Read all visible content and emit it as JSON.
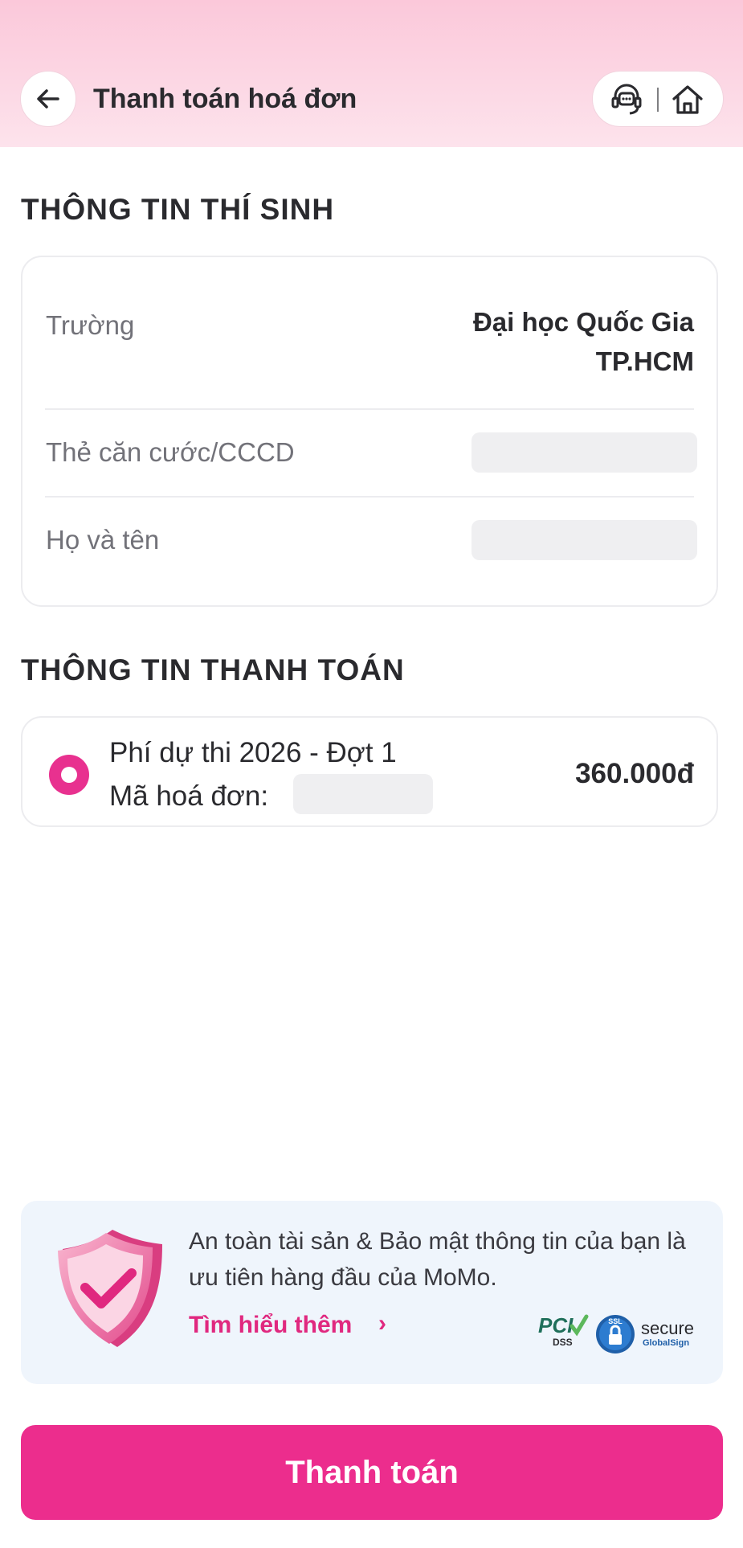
{
  "header": {
    "title": "Thanh toán hoá đơn",
    "back_icon": "arrow-left-icon",
    "support_icon": "support-chat-icon",
    "home_icon": "home-icon"
  },
  "candidate": {
    "section_title": "THÔNG TIN THÍ SINH",
    "rows": [
      {
        "label": "Trường",
        "value_line1": "Đại học Quốc Gia",
        "value_line2": "TP.HCM"
      },
      {
        "label": "Thẻ căn cước/CCCD",
        "value": ""
      },
      {
        "label": "Họ và tên",
        "value": ""
      }
    ]
  },
  "payment": {
    "section_title": "THÔNG TIN THANH TOÁN",
    "fee_name": "Phí dự thi 2026 - Đợt 1",
    "invoice_label": "Mã hoá đơn:",
    "invoice_value": "",
    "amount": "360.000đ",
    "selected": true
  },
  "safety": {
    "text": "An toàn tài sản & Bảo mật thông tin của bạn là ưu tiên hàng đầu của MoMo.",
    "link": "Tìm hiểu thêm",
    "link_chevron": "›",
    "badge_pci_title": "PCI",
    "badge_pci_sub": "DSS",
    "badge_ssl": "SSL",
    "badge_secure": "secure",
    "badge_globalsign": "GlobalSign"
  },
  "footer": {
    "pay_label": "Thanh toán"
  },
  "colors": {
    "accent": "#ec2d8d",
    "header_top": "#fbc8da",
    "header_bottom": "#fde3ec",
    "safety_bg": "#eff5fc"
  }
}
